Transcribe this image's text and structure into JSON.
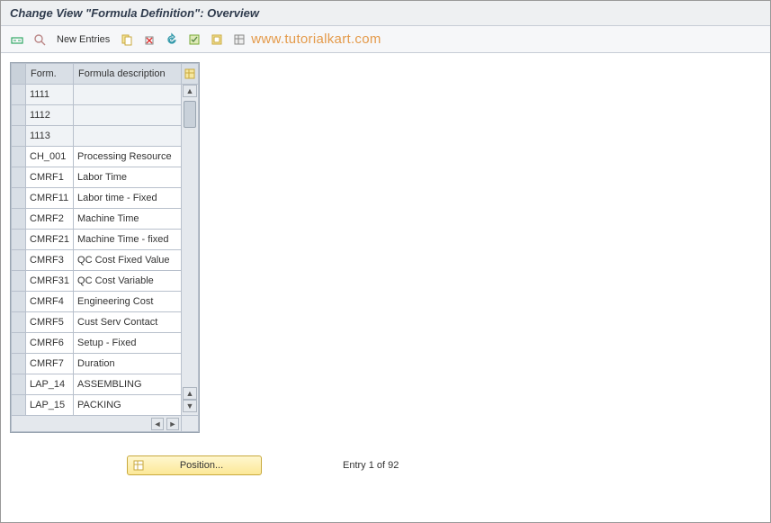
{
  "title": "Change View \"Formula Definition\": Overview",
  "toolbar": {
    "new_entries": "New Entries"
  },
  "watermark": "www.tutorialkart.com",
  "table": {
    "headers": {
      "form": "Form.",
      "desc": "Formula description"
    },
    "rows": [
      {
        "form": "1111",
        "desc": "",
        "editable": true
      },
      {
        "form": "1112",
        "desc": "",
        "editable": true
      },
      {
        "form": "1113",
        "desc": "",
        "editable": true
      },
      {
        "form": "CH_001",
        "desc": "Processing Resource"
      },
      {
        "form": "CMRF1",
        "desc": "Labor Time"
      },
      {
        "form": "CMRF11",
        "desc": "Labor time - Fixed"
      },
      {
        "form": "CMRF2",
        "desc": "Machine Time"
      },
      {
        "form": "CMRF21",
        "desc": "Machine Time - fixed"
      },
      {
        "form": "CMRF3",
        "desc": "QC Cost Fixed Value"
      },
      {
        "form": "CMRF31",
        "desc": "QC Cost Variable"
      },
      {
        "form": "CMRF4",
        "desc": "Engineering Cost"
      },
      {
        "form": "CMRF5",
        "desc": "Cust Serv Contact"
      },
      {
        "form": "CMRF6",
        "desc": "Setup - Fixed"
      },
      {
        "form": "CMRF7",
        "desc": "Duration"
      },
      {
        "form": "LAP_14",
        "desc": "ASSEMBLING"
      },
      {
        "form": "LAP_15",
        "desc": "PACKING"
      }
    ]
  },
  "footer": {
    "position_label": "Position...",
    "entry_status": "Entry 1 of 92"
  }
}
